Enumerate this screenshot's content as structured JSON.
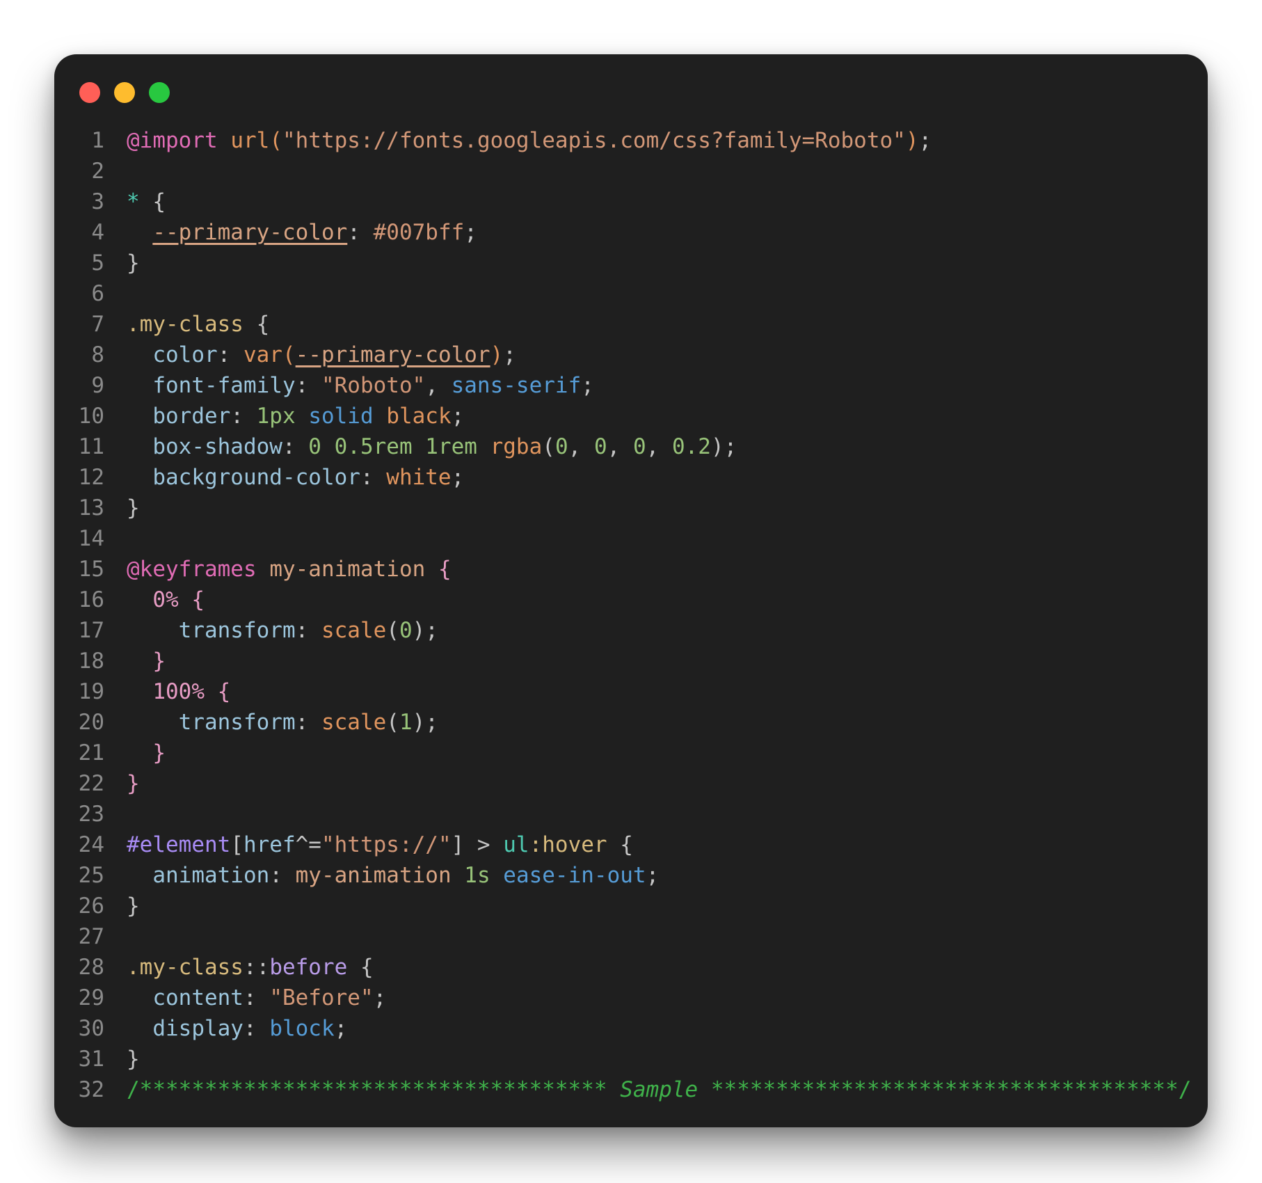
{
  "window": {
    "traffic_lights": [
      {
        "name": "close",
        "color": "#ff5f57"
      },
      {
        "name": "minimize",
        "color": "#febc2e"
      },
      {
        "name": "zoom",
        "color": "#28c840"
      }
    ]
  },
  "editor": {
    "lines": [
      {
        "n": "1",
        "tokens": [
          [
            "@import",
            "c-at"
          ],
          [
            " ",
            ""
          ],
          [
            "url(",
            "c-fn"
          ],
          [
            "\"https://fonts.googleapis.com/css?family=Roboto\"",
            "c-str"
          ],
          [
            ")",
            "c-fn"
          ],
          [
            ";",
            "c-punc"
          ]
        ]
      },
      {
        "n": "2",
        "tokens": []
      },
      {
        "n": "3",
        "tokens": [
          [
            "*",
            "c-star"
          ],
          [
            " {",
            "c-punc"
          ]
        ]
      },
      {
        "n": "4",
        "tokens": [
          [
            "  ",
            ""
          ],
          [
            "--primary-color",
            "c-var"
          ],
          [
            ": ",
            "c-punc"
          ],
          [
            "#007bff",
            "c-hex"
          ],
          [
            ";",
            "c-punc"
          ]
        ]
      },
      {
        "n": "5",
        "tokens": [
          [
            "}",
            "c-punc"
          ]
        ]
      },
      {
        "n": "6",
        "tokens": []
      },
      {
        "n": "7",
        "tokens": [
          [
            ".my-class",
            "c-class"
          ],
          [
            " {",
            "c-punc"
          ]
        ]
      },
      {
        "n": "8",
        "tokens": [
          [
            "  ",
            ""
          ],
          [
            "color",
            "c-prop"
          ],
          [
            ": ",
            "c-punc"
          ],
          [
            "var(",
            "c-fn"
          ],
          [
            "--primary-color",
            "c-var"
          ],
          [
            ")",
            "c-fn"
          ],
          [
            ";",
            "c-punc"
          ]
        ]
      },
      {
        "n": "9",
        "tokens": [
          [
            "  ",
            ""
          ],
          [
            "font-family",
            "c-prop"
          ],
          [
            ": ",
            "c-punc"
          ],
          [
            "\"Roboto\"",
            "c-str"
          ],
          [
            ", ",
            "c-punc"
          ],
          [
            "sans-serif",
            "c-kw"
          ],
          [
            ";",
            "c-punc"
          ]
        ]
      },
      {
        "n": "10",
        "tokens": [
          [
            "  ",
            ""
          ],
          [
            "border",
            "c-prop"
          ],
          [
            ": ",
            "c-punc"
          ],
          [
            "1px",
            "c-num"
          ],
          [
            " ",
            ""
          ],
          [
            "solid",
            "c-kw"
          ],
          [
            " ",
            ""
          ],
          [
            "black",
            "c-val"
          ],
          [
            ";",
            "c-punc"
          ]
        ]
      },
      {
        "n": "11",
        "tokens": [
          [
            "  ",
            ""
          ],
          [
            "box-shadow",
            "c-prop"
          ],
          [
            ": ",
            "c-punc"
          ],
          [
            "0 0.5rem 1rem",
            "c-num"
          ],
          [
            " ",
            ""
          ],
          [
            "rgba",
            "c-fn"
          ],
          [
            "(",
            "c-punc"
          ],
          [
            "0",
            "c-num"
          ],
          [
            ", ",
            "c-punc"
          ],
          [
            "0",
            "c-num"
          ],
          [
            ", ",
            "c-punc"
          ],
          [
            "0",
            "c-num"
          ],
          [
            ", ",
            "c-punc"
          ],
          [
            "0.2",
            "c-num"
          ],
          [
            ");",
            "c-punc"
          ]
        ]
      },
      {
        "n": "12",
        "tokens": [
          [
            "  ",
            ""
          ],
          [
            "background-color",
            "c-prop"
          ],
          [
            ": ",
            "c-punc"
          ],
          [
            "white",
            "c-val"
          ],
          [
            ";",
            "c-punc"
          ]
        ]
      },
      {
        "n": "13",
        "tokens": [
          [
            "}",
            "c-punc"
          ]
        ]
      },
      {
        "n": "14",
        "tokens": []
      },
      {
        "n": "15",
        "tokens": [
          [
            "@keyframes",
            "c-at"
          ],
          [
            " ",
            ""
          ],
          [
            "my-animation",
            "c-kf"
          ],
          [
            " {",
            "c-brace-pk"
          ]
        ]
      },
      {
        "n": "16",
        "tokens": [
          [
            "  ",
            ""
          ],
          [
            "0%",
            "c-pct"
          ],
          [
            " {",
            "c-brace-pk"
          ]
        ]
      },
      {
        "n": "17",
        "tokens": [
          [
            "    ",
            ""
          ],
          [
            "transform",
            "c-prop"
          ],
          [
            ": ",
            "c-punc"
          ],
          [
            "scale",
            "c-fn"
          ],
          [
            "(",
            "c-punc"
          ],
          [
            "0",
            "c-num"
          ],
          [
            ");",
            "c-punc"
          ]
        ]
      },
      {
        "n": "18",
        "tokens": [
          [
            "  ",
            ""
          ],
          [
            "}",
            "c-brace-pk"
          ]
        ]
      },
      {
        "n": "19",
        "tokens": [
          [
            "  ",
            ""
          ],
          [
            "100%",
            "c-pct"
          ],
          [
            " {",
            "c-brace-pk"
          ]
        ]
      },
      {
        "n": "20",
        "tokens": [
          [
            "    ",
            ""
          ],
          [
            "transform",
            "c-prop"
          ],
          [
            ": ",
            "c-punc"
          ],
          [
            "scale",
            "c-fn"
          ],
          [
            "(",
            "c-punc"
          ],
          [
            "1",
            "c-num"
          ],
          [
            ");",
            "c-punc"
          ]
        ]
      },
      {
        "n": "21",
        "tokens": [
          [
            "  ",
            ""
          ],
          [
            "}",
            "c-brace-pk"
          ]
        ]
      },
      {
        "n": "22",
        "tokens": [
          [
            "}",
            "c-brace-pk"
          ]
        ]
      },
      {
        "n": "23",
        "tokens": []
      },
      {
        "n": "24",
        "tokens": [
          [
            "#element",
            "c-id"
          ],
          [
            "[",
            "c-punc"
          ],
          [
            "href",
            "c-attr"
          ],
          [
            "^=",
            "c-punc"
          ],
          [
            "\"https://\"",
            "c-str"
          ],
          [
            "] > ",
            "c-punc"
          ],
          [
            "ul",
            "c-tag"
          ],
          [
            ":hover",
            "c-pseudo"
          ],
          [
            " {",
            "c-punc"
          ]
        ]
      },
      {
        "n": "25",
        "tokens": [
          [
            "  ",
            ""
          ],
          [
            "animation",
            "c-prop"
          ],
          [
            ": ",
            "c-punc"
          ],
          [
            "my-animation",
            "c-kf"
          ],
          [
            " ",
            ""
          ],
          [
            "1s",
            "c-num"
          ],
          [
            " ",
            ""
          ],
          [
            "ease-in-out",
            "c-kw"
          ],
          [
            ";",
            "c-punc"
          ]
        ]
      },
      {
        "n": "26",
        "tokens": [
          [
            "}",
            "c-punc"
          ]
        ]
      },
      {
        "n": "27",
        "tokens": []
      },
      {
        "n": "28",
        "tokens": [
          [
            ".my-class",
            "c-class"
          ],
          [
            "::",
            "c-punc"
          ],
          [
            "before",
            "c-pel"
          ],
          [
            " {",
            "c-punc"
          ]
        ]
      },
      {
        "n": "29",
        "tokens": [
          [
            "  ",
            ""
          ],
          [
            "content",
            "c-prop"
          ],
          [
            ": ",
            "c-punc"
          ],
          [
            "\"Before\"",
            "c-str"
          ],
          [
            ";",
            "c-punc"
          ]
        ]
      },
      {
        "n": "30",
        "tokens": [
          [
            "  ",
            ""
          ],
          [
            "display",
            "c-prop"
          ],
          [
            ": ",
            "c-punc"
          ],
          [
            "block",
            "c-kw"
          ],
          [
            ";",
            "c-punc"
          ]
        ]
      },
      {
        "n": "31",
        "tokens": [
          [
            "}",
            "c-punc"
          ]
        ]
      },
      {
        "n": "32",
        "tokens": [
          [
            "/************************************ ",
            "c-comment"
          ],
          [
            "Sample",
            "c-cm-it"
          ],
          [
            " ************************************/",
            "c-comment"
          ]
        ]
      }
    ]
  }
}
